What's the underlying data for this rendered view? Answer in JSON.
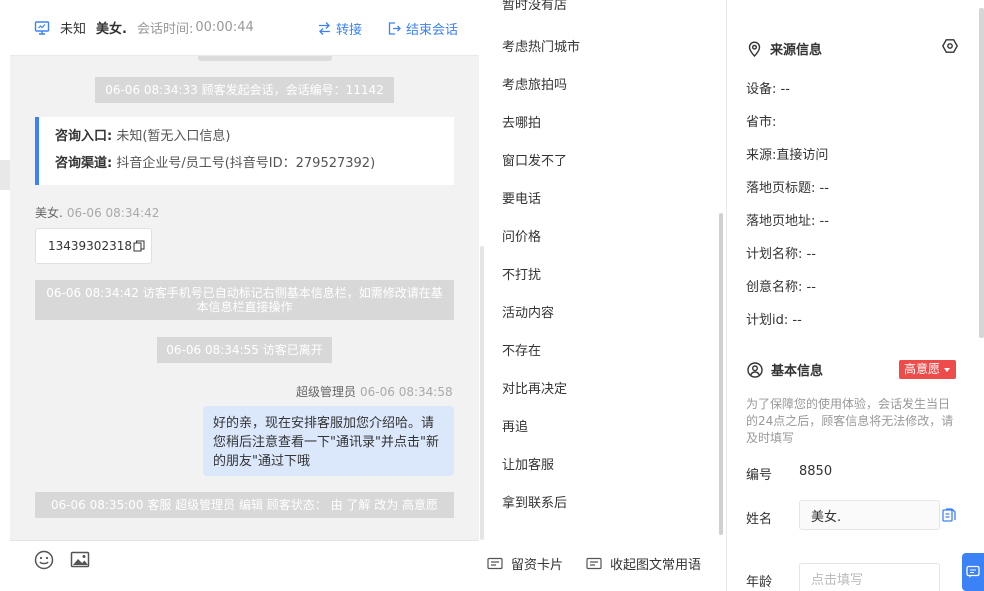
{
  "header": {
    "status": "未知",
    "visitor_name": "美女.",
    "time_label": "会话时间:",
    "time_value": "00:00:44",
    "transfer_label": "转接",
    "end_label": "结束会话"
  },
  "chat": {
    "sys_start": "06-06 08:34:33 顾客发起会话，会话编号：11142",
    "entry_label": "咨询入口:",
    "entry_value": "未知(暂无入口信息)",
    "channel_label": "咨询渠道:",
    "channel_value": "抖音企业号/员工号(抖音号ID：279527392)",
    "visitor_sender": "美女.",
    "visitor_time": "06-06 08:34:42",
    "phone": "13439302318",
    "sys_phone_marked": "06-06 08:34:42 访客手机号已自动标记右侧基本信息栏，如需修改请在基本信息栏直接操作",
    "sys_left": "06-06 08:34:55 访客已离开",
    "agent_sender": "超级管理员",
    "agent_time": "06-06 08:34:58",
    "agent_message": "好的亲，现在安排客服加您介绍哈。请您稍后注意查看一下\"通讯录\"并点击\"新的朋友\"通过下哦",
    "sys_status_change": "06-06 08:35:00 客服 超级管理员 编辑 顾客状态： 由 了解 改为 高意愿"
  },
  "phrases": {
    "items": [
      "暂时没有店",
      "考虑热门城市",
      "考虑旅拍吗",
      "去哪拍",
      "窗口发不了",
      "要电话",
      "问价格",
      "不打扰",
      "活动内容",
      "不存在",
      "对比再决定",
      "再追",
      "让加客服",
      "拿到联系后"
    ]
  },
  "footer": {
    "card_label": "留资卡片",
    "collapse_label": "收起图文常用语"
  },
  "source": {
    "title": "来源信息",
    "device_label": "设备:",
    "device_value": "--",
    "region_label": "省市:",
    "region_value": "",
    "origin_label": "来源:",
    "origin_value": "直接访问",
    "page_title_label": "落地页标题:",
    "page_title_value": "--",
    "page_url_label": "落地页地址:",
    "page_url_value": "--",
    "plan_label": "计划名称:",
    "plan_value": "--",
    "creative_label": "创意名称:",
    "creative_value": "--",
    "plan_id_label": "计划id:",
    "plan_id_value": "--"
  },
  "basic": {
    "title": "基本信息",
    "tag": "高意愿",
    "notice": "为了保障您的使用体验，会话发生当日的24点之后，顾客信息将无法修改，请及时填写",
    "id_label": "编号",
    "id_value": "8850",
    "name_label": "姓名",
    "name_value": "美女.",
    "age_label": "年龄",
    "age_placeholder": "点击填写"
  },
  "colors": {
    "accent": "#3b82f6",
    "tag_red": "#ee4b4b",
    "agent_bubble": "#dbe7fb",
    "system_bubble": "#d8d8d8"
  }
}
